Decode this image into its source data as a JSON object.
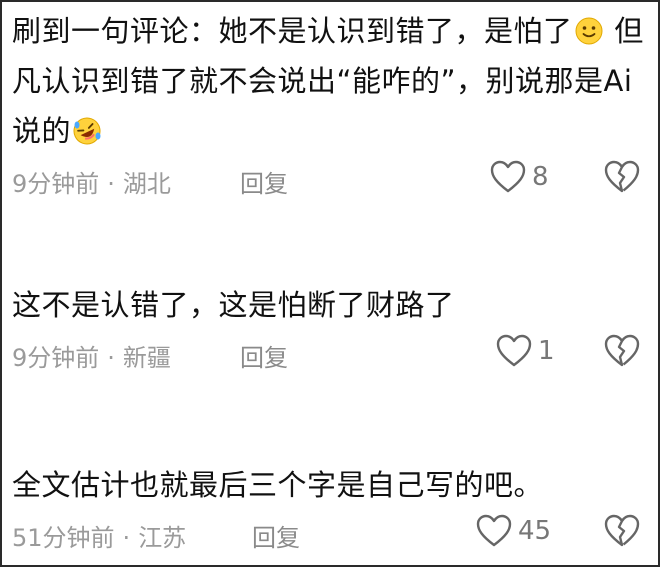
{
  "comments": [
    {
      "text_part1": "刷到一句评论：她不是认识到错了，是怕了",
      "emoji1": "slightly-smiling-face-icon",
      "text_part2": " 但凡认识到错了就不会说出“能咋的”，别说那是Ai说的",
      "emoji2": "rolling-on-floor-laughing-icon",
      "time": "9分钟前",
      "location": "湖北",
      "reply_label": "回复",
      "likes": "8"
    },
    {
      "text": "这不是认错了，这是怕断了财路了",
      "time": "9分钟前",
      "location": "新疆",
      "reply_label": "回复",
      "likes": "1"
    },
    {
      "text": "全文估计也就最后三个字是自己写的吧。",
      "time": "51分钟前",
      "location": "江苏",
      "reply_label": "回复",
      "likes": "45"
    }
  ],
  "separator": "·",
  "colors": {
    "text": "#111111",
    "meta": "#9a9a9a",
    "border": "#2a2a2a",
    "emoji_face": "#ffd23c"
  }
}
